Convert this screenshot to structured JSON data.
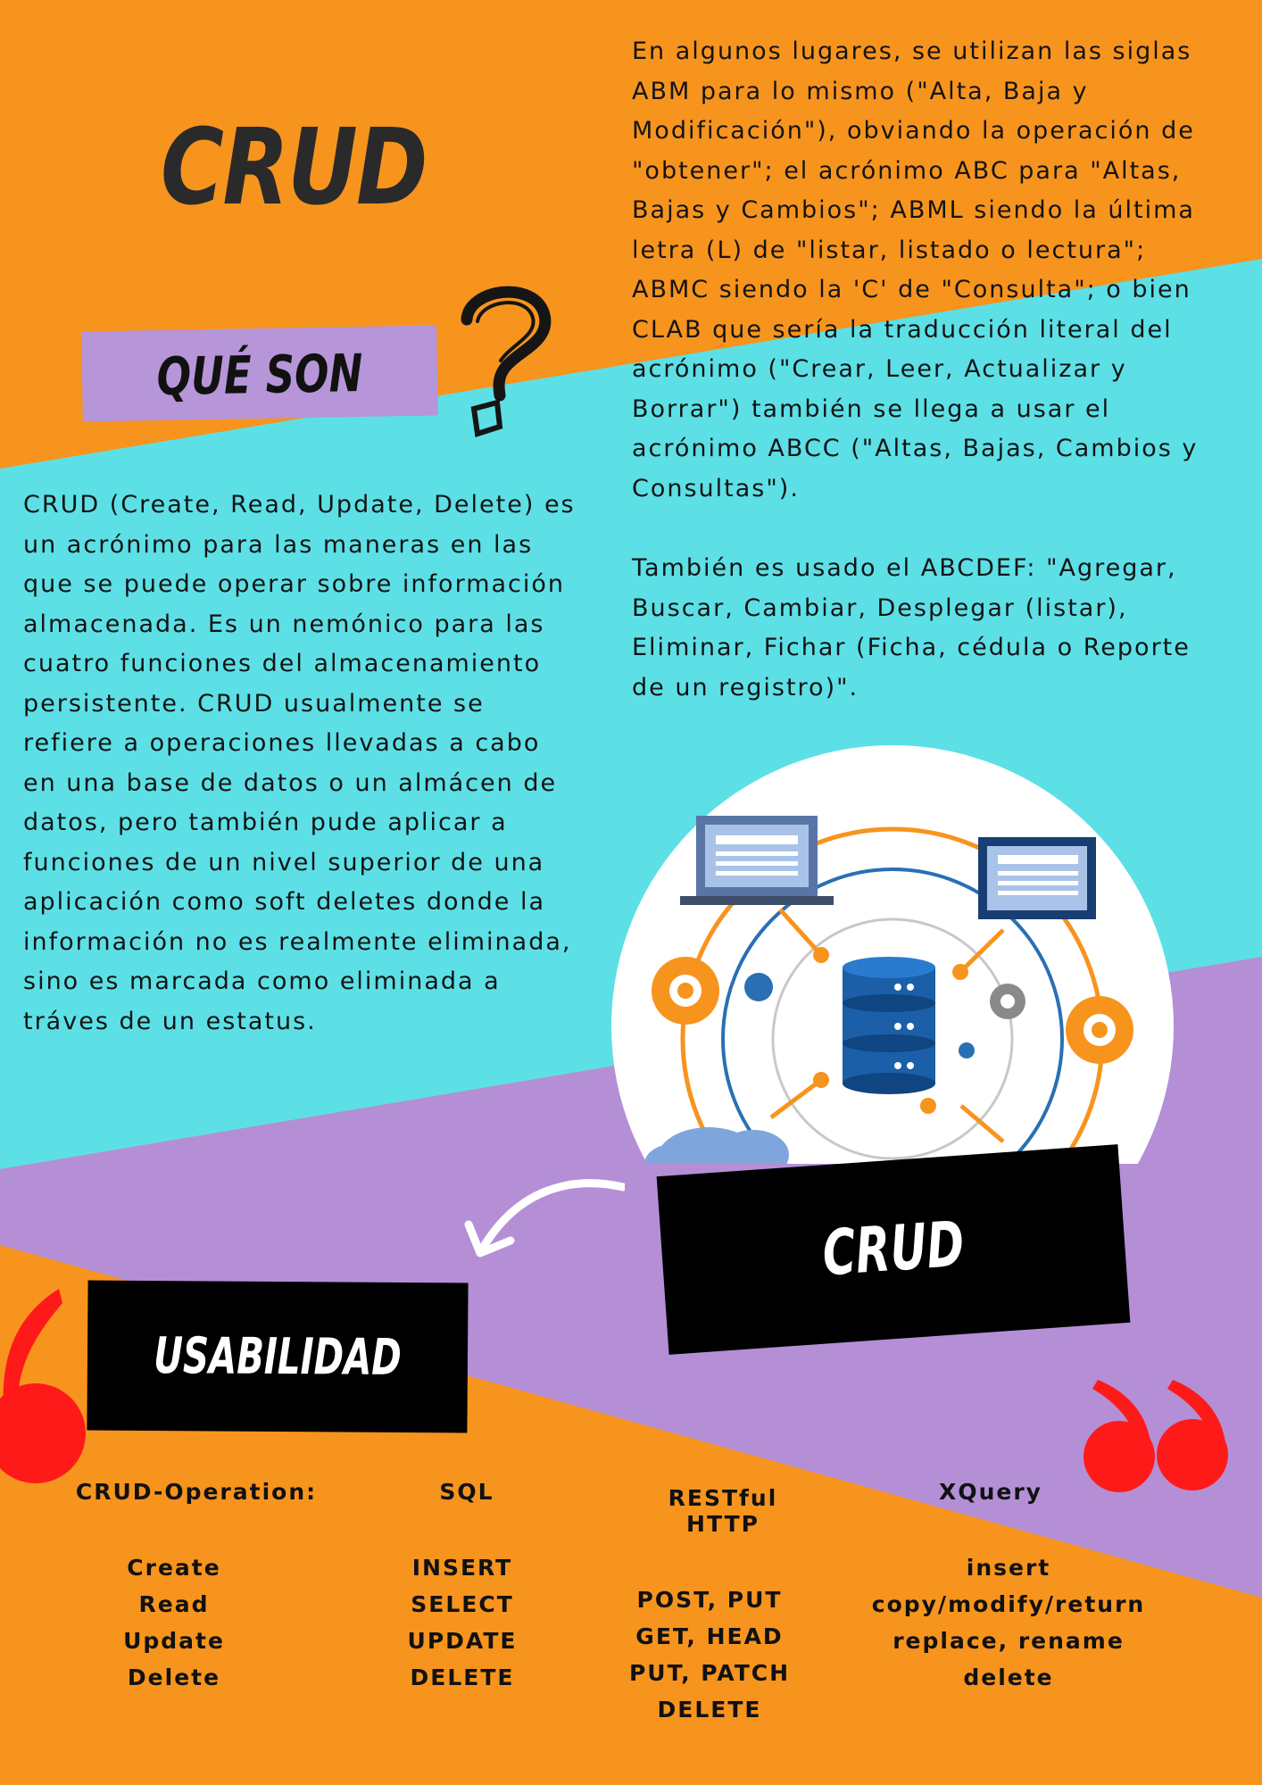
{
  "colors": {
    "orange": "#f7941e",
    "cyan": "#5ce0e6",
    "purple": "#b48fd6",
    "black": "#000000",
    "red_quote": "#ff1a1a",
    "text": "#141414"
  },
  "header": {
    "title": "CRUD"
  },
  "que_son": {
    "label": "QUÉ SON"
  },
  "intro": {
    "text": "CRUD (Create, Read, Update, Delete) es\nun acrónimo para las maneras en las\nque se puede operar sobre información\nalmacenada. Es un nemónico para las\ncuatro funciones del almacenamiento\npersistente. CRUD usualmente se\nrefiere a operaciones llevadas a cabo\nen una base de datos o un almácen de\ndatos, pero también pude aplicar a\nfunciones de un nivel superior de una\naplicación como soft deletes donde la\ninformación no es realmente eliminada,\nsino es marcada como eliminada a\ntráves de un estatus."
  },
  "right": {
    "paragraph1": "En algunos lugares, se utilizan las siglas\nABM para lo mismo (\"Alta, Baja y\nModificación\"), obviando la operación de\n\"obtener\"; el acrónimo ABC para \"Altas,\nBajas y Cambios\"; ABML siendo la última\nletra (L) de \"listar, listado o lectura\";\nABMC siendo la 'C' de \"Consulta\"; o bien\nCLAB que sería la traducción literal del\nacrónimo (\"Crear, Leer, Actualizar y\nBorrar\") también se llega a usar el\nacrónimo ABCC (\"Altas, Bajas, Cambios y\nConsultas\").",
    "paragraph2": "También es usado el ABCDEF: \"Agregar,\nBuscar, Cambiar, Desplegar (listar),\nEliminar, Fichar (Ficha, cédula o Reporte\nde un registro)\"."
  },
  "illustration": {
    "icons": [
      "laptop-icon",
      "monitor-icon",
      "database-icon",
      "gear-icon",
      "cloud-icon"
    ]
  },
  "crud_label": "CRUD",
  "usabilidad": {
    "label": "USABILIDAD"
  },
  "table": {
    "columns": [
      {
        "header": "CRUD-Operation:",
        "items": "Create\n Read\nUpdate\n Delete"
      },
      {
        "header": "SQL",
        "items": "INSERT\nSELECT\nUPDATE\n DELETE"
      },
      {
        "header": "RESTful HTTP",
        "items": "POST, PUT\n GET, HEAD\n PUT, PATCH\n DELETE"
      },
      {
        "header": "XQuery",
        "items": "insert\ncopy/modify/return\nreplace, rename\ndelete"
      }
    ]
  }
}
